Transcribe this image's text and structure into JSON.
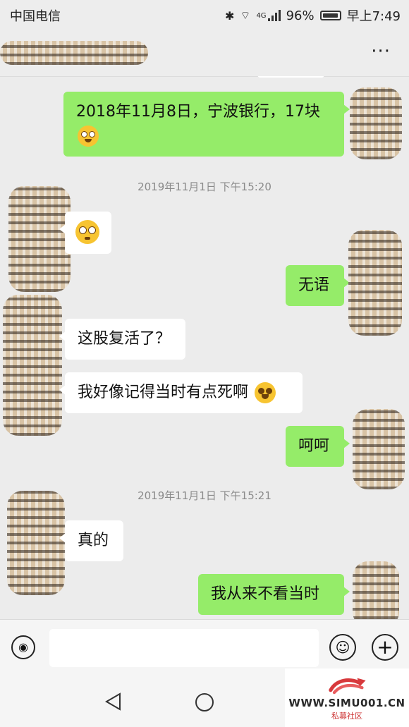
{
  "status_bar": {
    "carrier": "中国电信",
    "battery": "96%",
    "time": "早上7:49",
    "network": "4G"
  },
  "header": {
    "more_label": "···"
  },
  "messages": [
    {
      "from": "me",
      "text": "2018年11月8日，宁波银行，17块"
    },
    {
      "type": "time",
      "text": "2019年11月1日 下午15:20"
    },
    {
      "from": "other",
      "emoji": "flushed-face"
    },
    {
      "from": "me",
      "text": "无语"
    },
    {
      "from": "other",
      "text": "这股复活了？"
    },
    {
      "from": "other",
      "text": "我好像记得当时有点死啊"
    },
    {
      "from": "me",
      "text": "呵呵"
    },
    {
      "type": "time",
      "text": "2019年11月1日 下午15:21"
    },
    {
      "from": "other",
      "text": "真的"
    },
    {
      "from": "me",
      "text": "我从来不看当时"
    }
  ],
  "input_bar": {
    "voice_icon": "voice-icon",
    "emoji_icon": "emoji-icon",
    "plus_icon": "plus-icon"
  },
  "watermark": {
    "site": "WWW.SIMU001.CN",
    "caption": "私募社区"
  }
}
